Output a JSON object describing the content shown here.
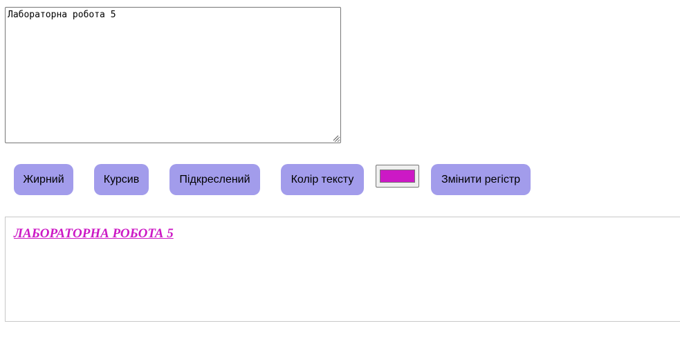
{
  "editor": {
    "value": "Лабораторна робота 5"
  },
  "toolbar": {
    "bold_label": "Жирний",
    "italic_label": "Курсив",
    "underline_label": "Підкреслений",
    "color_label": "Колір тексту",
    "color_value": "#cc19c5",
    "case_label": "Змінити регістр"
  },
  "output": {
    "text": "Лабораторна робота 5",
    "color": "#cc19c5"
  },
  "colors": {
    "button_bg": "#a29ceb"
  }
}
